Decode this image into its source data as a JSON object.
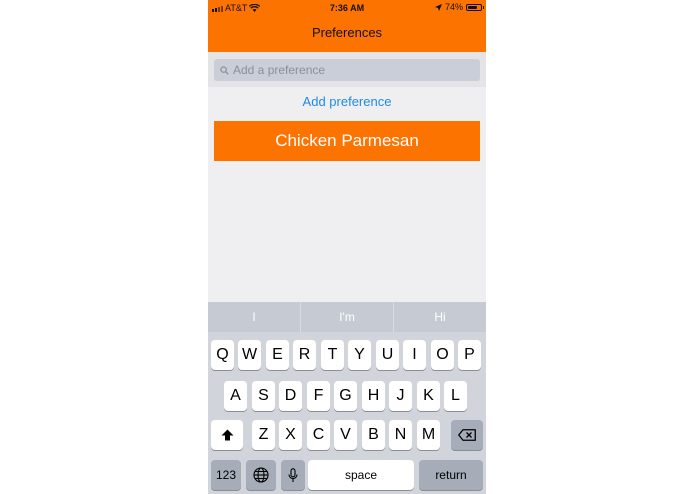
{
  "status_bar": {
    "carrier": "AT&T",
    "time": "7:36 AM",
    "battery": "74%"
  },
  "nav": {
    "title": "Preferences"
  },
  "search": {
    "placeholder": "Add a preference"
  },
  "add_link": "Add preference",
  "preferences": [
    "Chicken Parmesan"
  ],
  "keyboard": {
    "suggestions": [
      "I",
      "I'm",
      "Hi"
    ],
    "row1": [
      "Q",
      "W",
      "E",
      "R",
      "T",
      "Y",
      "U",
      "I",
      "O",
      "P"
    ],
    "row2": [
      "A",
      "S",
      "D",
      "F",
      "G",
      "H",
      "J",
      "K",
      "L"
    ],
    "row3": [
      "Z",
      "X",
      "C",
      "V",
      "B",
      "N",
      "M"
    ],
    "numbers_label": "123",
    "space_label": "space",
    "return_label": "return"
  }
}
